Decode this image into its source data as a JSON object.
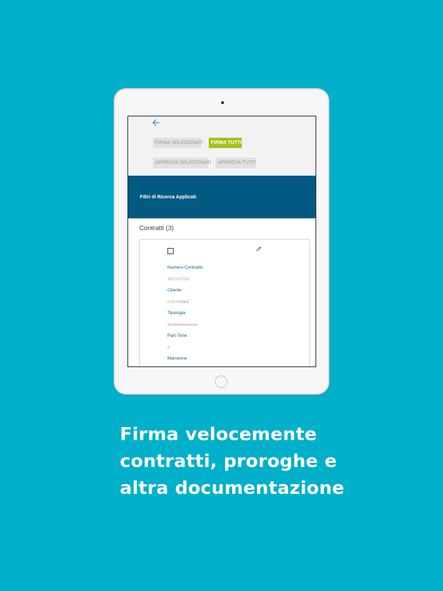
{
  "screen": {
    "actions": {
      "firma_selezionati": "FIRMA SELEZIONATI",
      "firma_tutti": "FIRMA TUTTI",
      "approva_selezionati": "APPROVA SELEZIONATI",
      "approva_tutti": "APPROVA TUTTI"
    },
    "filter_banner": "Filtri di Ricerca Applicati",
    "contracts_title": "Contratti (3)",
    "card": {
      "fields": [
        {
          "label": "Numero Contratto",
          "value": "2017XYZ123"
        },
        {
          "label": "Cliente",
          "value": "CUSTOMER"
        },
        {
          "label": "Tipologia",
          "value": "Somministrazione"
        },
        {
          "label": "Part-Time",
          "value": "0"
        },
        {
          "label": "Mansione",
          "value": ""
        }
      ]
    }
  },
  "caption": {
    "line1": "Firma velocemente",
    "line2": "contratti, proroghe e",
    "line3": "altra documentazione"
  },
  "colors": {
    "background": "#00b0cb",
    "banner": "#025a82",
    "accent_button": "#a4c21a",
    "label": "#075f8c"
  },
  "icons": [
    "back-arrow-icon",
    "pencil-icon",
    "checkbox-icon"
  ]
}
